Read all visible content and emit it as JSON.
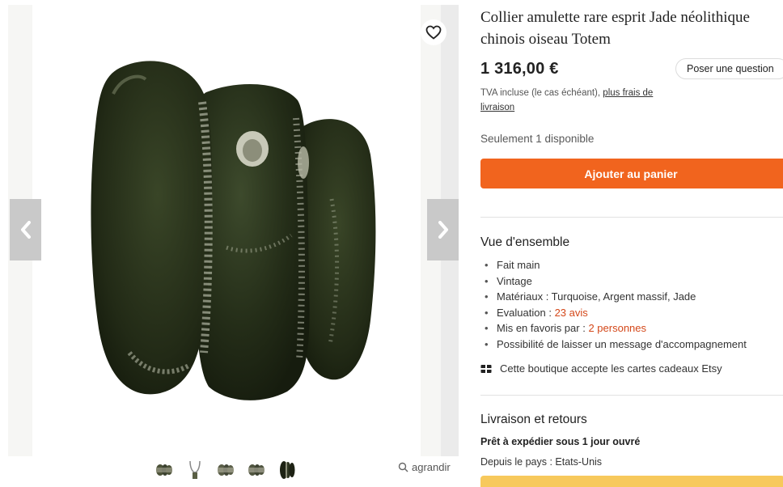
{
  "listing": {
    "title_line1": "Collier amulette rare esprit Jade néolithique",
    "title_line2": "chinois oiseau Totem",
    "price": "1 316,00 €",
    "ask_question_label": "Poser une question",
    "tva_text": "TVA incluse (le cas échéant),",
    "shipping_link_line1": "plus frais de",
    "shipping_link_line2": "livraison",
    "stock_text": "Seulement 1 disponible",
    "add_to_cart_label": "Ajouter au panier"
  },
  "gallery": {
    "zoom_label": "agrandir",
    "thumbnails": [
      "thumbnail-pendant-front",
      "thumbnail-necklace",
      "thumbnail-pendant-side",
      "thumbnail-pendant-back",
      "thumbnail-pendant-dark"
    ]
  },
  "overview": {
    "heading": "Vue d'ensemble",
    "items": {
      "handmade": "Fait main",
      "vintage": "Vintage",
      "materials": "Matériaux : Turquoise, Argent massif, Jade",
      "rating_prefix": "Evaluation :",
      "rating_link": "23 avis",
      "favorites_prefix": "Mis en favoris par :",
      "favorites_link": "2 personnes",
      "message": "Possibilité de laisser un message d'accompagnement"
    },
    "giftcard_text": "Cette boutique accepte les cartes cadeaux Etsy"
  },
  "shipping": {
    "heading": "Livraison et retours",
    "ready_text": "Prêt à expédier sous 1 jour ouvré",
    "from_text": "Depuis le pays : Etats-Unis"
  },
  "colors": {
    "accent": "#f1641e",
    "link_red": "#d4481a",
    "jade": "#2b3420"
  }
}
